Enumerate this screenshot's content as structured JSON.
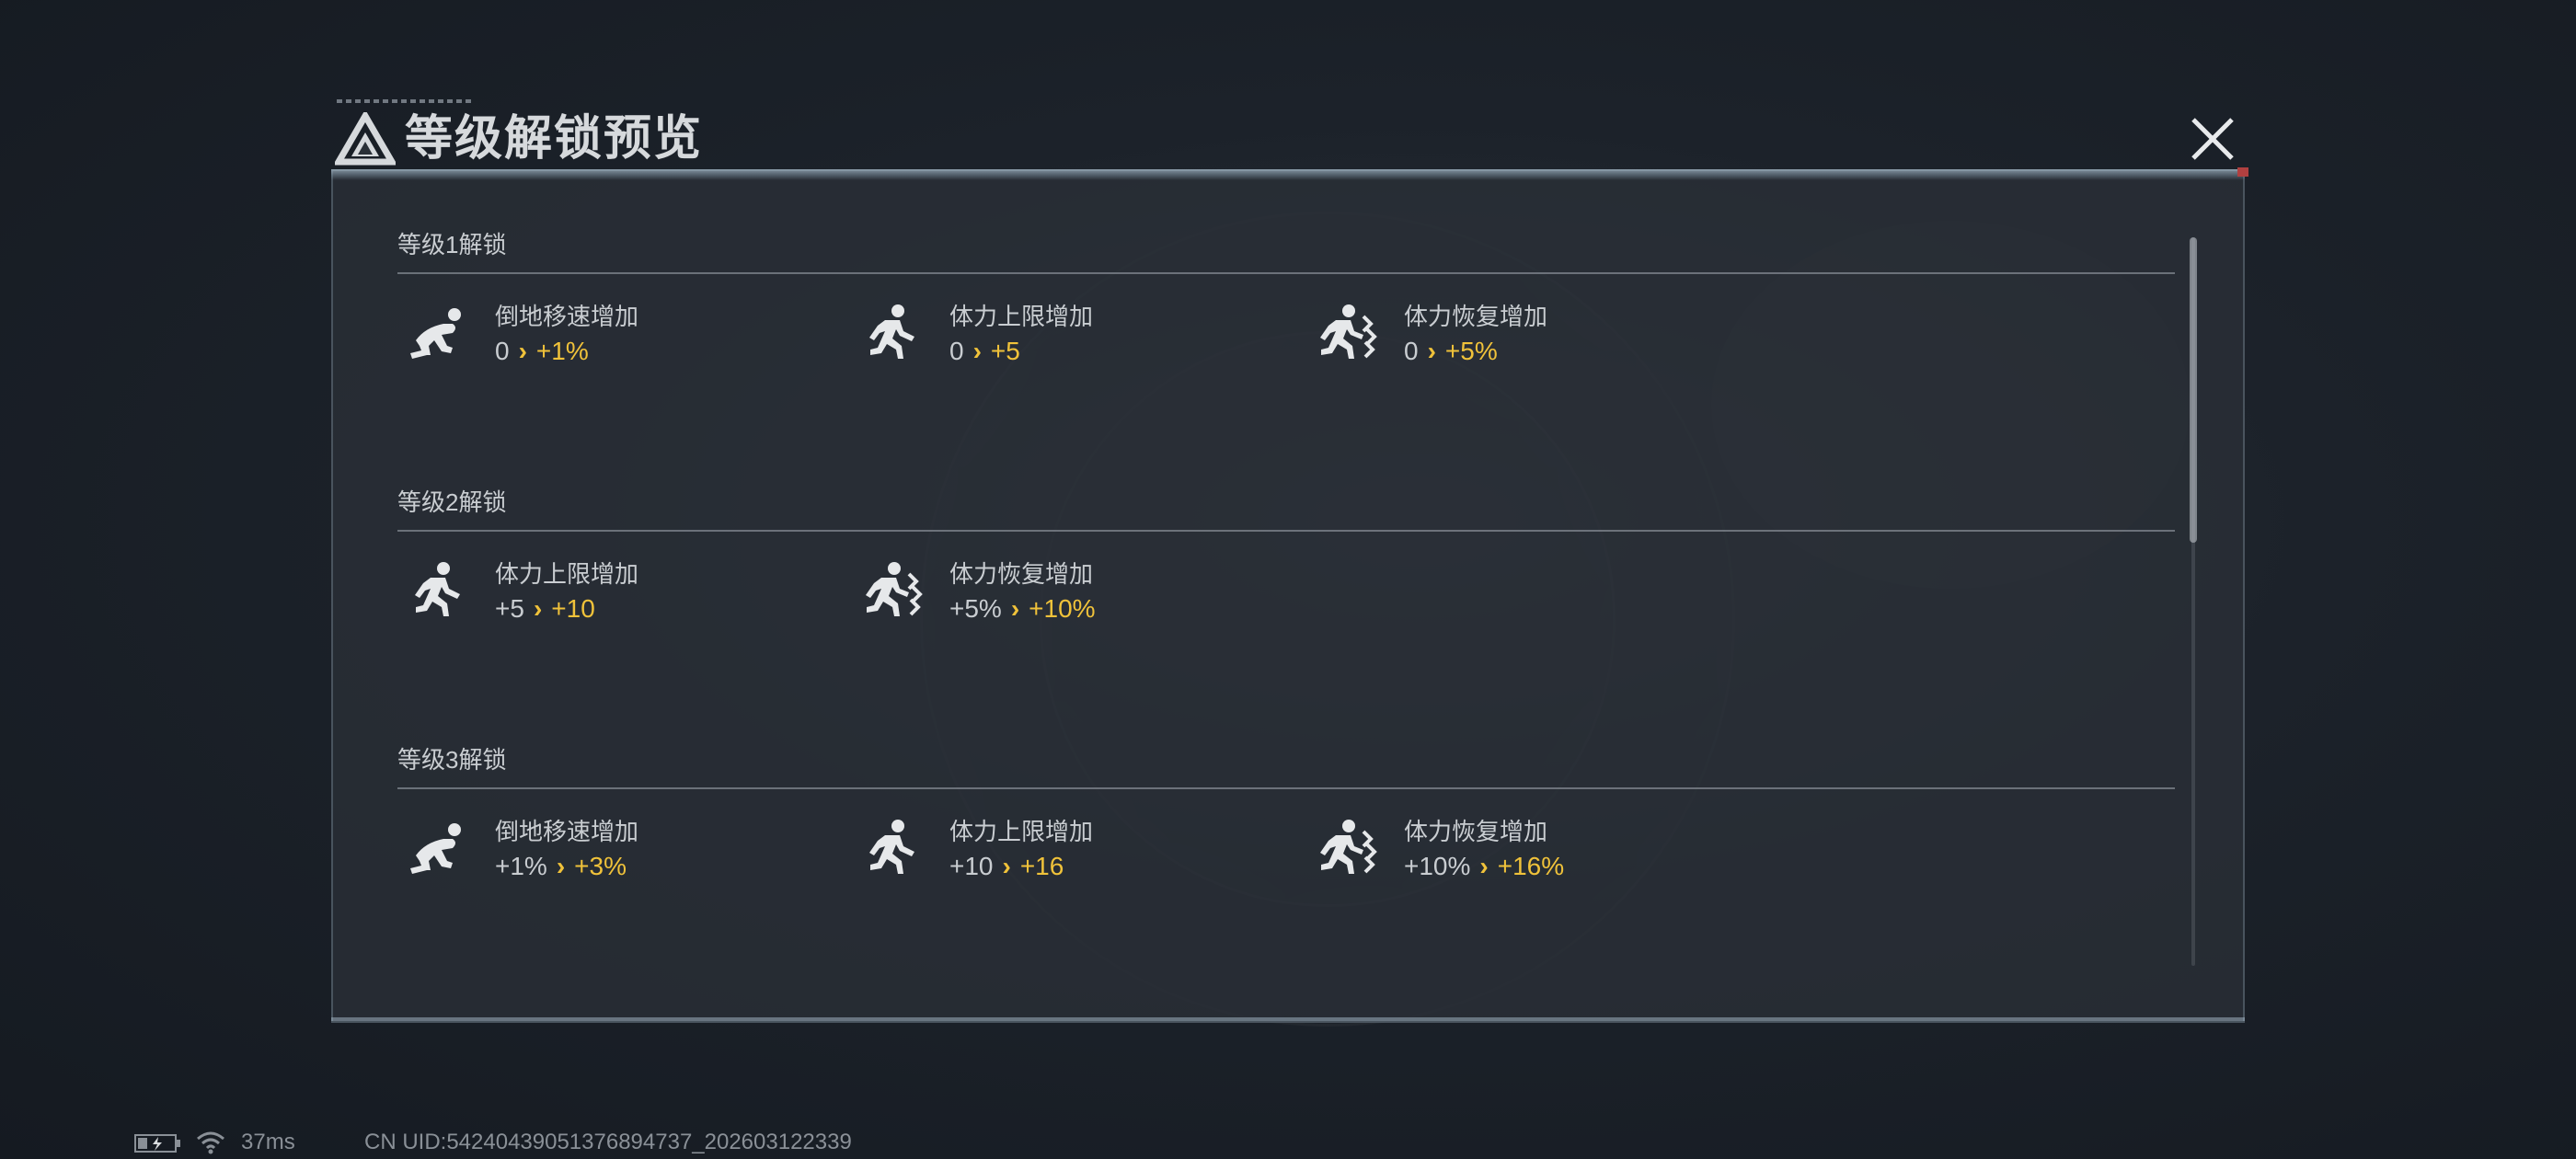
{
  "dialog": {
    "title": "等级解锁预览",
    "title_icon": "triangle-logo-icon",
    "close_icon": "close-icon"
  },
  "colors": {
    "accent": "#f0c23a",
    "text": "#c9cdd1",
    "panel_bg": "#2a3037",
    "page_bg": "#1c222a"
  },
  "sections": [
    {
      "title": "等级1解锁",
      "items": [
        {
          "icon": "crawl-icon",
          "name": "倒地移速增加",
          "from": "0",
          "to": "+1%"
        },
        {
          "icon": "run-icon",
          "name": "体力上限增加",
          "from": "0",
          "to": "+5"
        },
        {
          "icon": "run-recover-icon",
          "name": "体力恢复增加",
          "from": "0",
          "to": "+5%"
        }
      ]
    },
    {
      "title": "等级2解锁",
      "items": [
        {
          "icon": "run-icon",
          "name": "体力上限增加",
          "from": "+5",
          "to": "+10"
        },
        {
          "icon": "run-recover-icon",
          "name": "体力恢复增加",
          "from": "+5%",
          "to": "+10%"
        }
      ]
    },
    {
      "title": "等级3解锁",
      "items": [
        {
          "icon": "crawl-icon",
          "name": "倒地移速增加",
          "from": "+1%",
          "to": "+3%"
        },
        {
          "icon": "run-icon",
          "name": "体力上限增加",
          "from": "+10",
          "to": "+16"
        },
        {
          "icon": "run-recover-icon",
          "name": "体力恢复增加",
          "from": "+10%",
          "to": "+16%"
        }
      ]
    }
  ],
  "arrow_symbol": "›",
  "status_bar": {
    "battery_icon": "battery-charging-icon",
    "wifi_icon": "wifi-icon",
    "latency": "37ms",
    "uid": "CN UID:54240439051376894737_202603122339"
  }
}
